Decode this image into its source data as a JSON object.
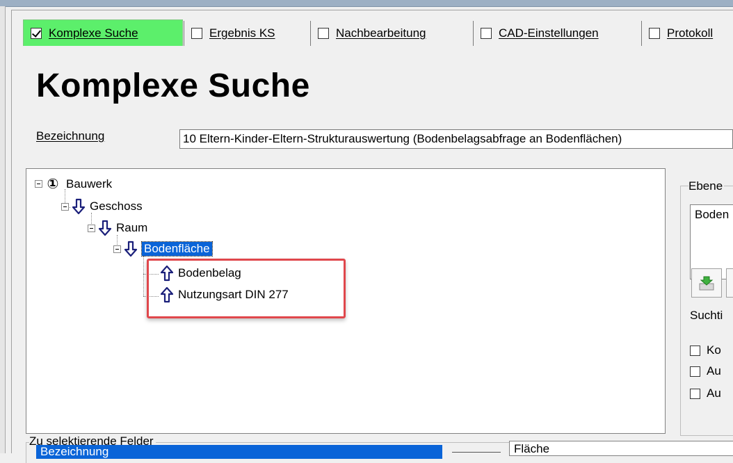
{
  "tabs": [
    {
      "label": "Komplexe Suche",
      "checked": true,
      "active": true
    },
    {
      "label": "Ergebnis KS",
      "checked": false,
      "active": false
    },
    {
      "label": "Nachbearbeitung",
      "checked": false,
      "active": false
    },
    {
      "label": "CAD-Einstellungen",
      "checked": false,
      "active": false
    },
    {
      "label": "Protokoll",
      "checked": false,
      "active": false
    }
  ],
  "page_title": "Komplexe Suche",
  "bezeichnung": {
    "label": "Bezeichnung",
    "value": "10 Eltern-Kinder-Eltern-Strukturauswertung (Bodenbelagsabfrage an Bodenflächen)"
  },
  "tree": {
    "root": {
      "label": "Bauwerk",
      "marker": "①"
    },
    "nodes": [
      {
        "label": "Geschoss",
        "icon": "arrow-down-icon"
      },
      {
        "label": "Raum",
        "icon": "arrow-down-icon"
      },
      {
        "label": "Bodenfläche",
        "icon": "arrow-down-icon",
        "selected": true
      },
      {
        "label": "Bodenbelag",
        "icon": "arrow-up-icon"
      },
      {
        "label": "Nutzungsart DIN 277",
        "icon": "arrow-up-icon"
      }
    ]
  },
  "right_panel": {
    "ebene_legend": "Ebene",
    "ebene_list_item": "Boden",
    "suchtiefe_label": "Suchti",
    "options": [
      {
        "label": "Ko",
        "checked": false
      },
      {
        "label": "Au",
        "checked": false
      },
      {
        "label": "Au",
        "checked": false
      }
    ]
  },
  "fields_group": {
    "legend": "Zu selektierende Felder",
    "selected_field": "Bezeichnung",
    "right_field": "Fläche"
  },
  "colors": {
    "active_tab": "#5cef6b",
    "selection": "#0a64d8",
    "highlight_border": "#e0474c",
    "arrow_fill": "#ffffff",
    "arrow_stroke": "#1a1f7a"
  }
}
